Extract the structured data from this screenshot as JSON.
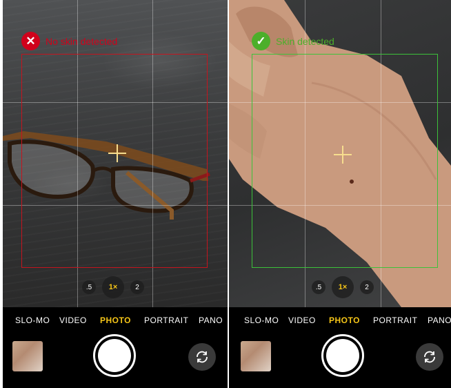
{
  "panels": [
    {
      "status": {
        "text": "No skin detected",
        "icon": "close-icon",
        "color": "#d0021b"
      },
      "zoom": [
        ".5",
        "1×",
        "2"
      ],
      "modes": [
        "SLO-MO",
        "VIDEO",
        "PHOTO",
        "PORTRAIT",
        "PANO"
      ],
      "active_mode": "PHOTO",
      "box_color": "#c5141e"
    },
    {
      "status": {
        "text": "Skin detected",
        "icon": "check-icon",
        "color": "#4caf2a"
      },
      "zoom": [
        ".5",
        "1×",
        "2"
      ],
      "modes": [
        "SLO-MO",
        "VIDEO",
        "PHOTO",
        "PORTRAIT",
        "PANO"
      ],
      "active_mode": "PHOTO",
      "box_color": "#3cc23a"
    }
  ]
}
